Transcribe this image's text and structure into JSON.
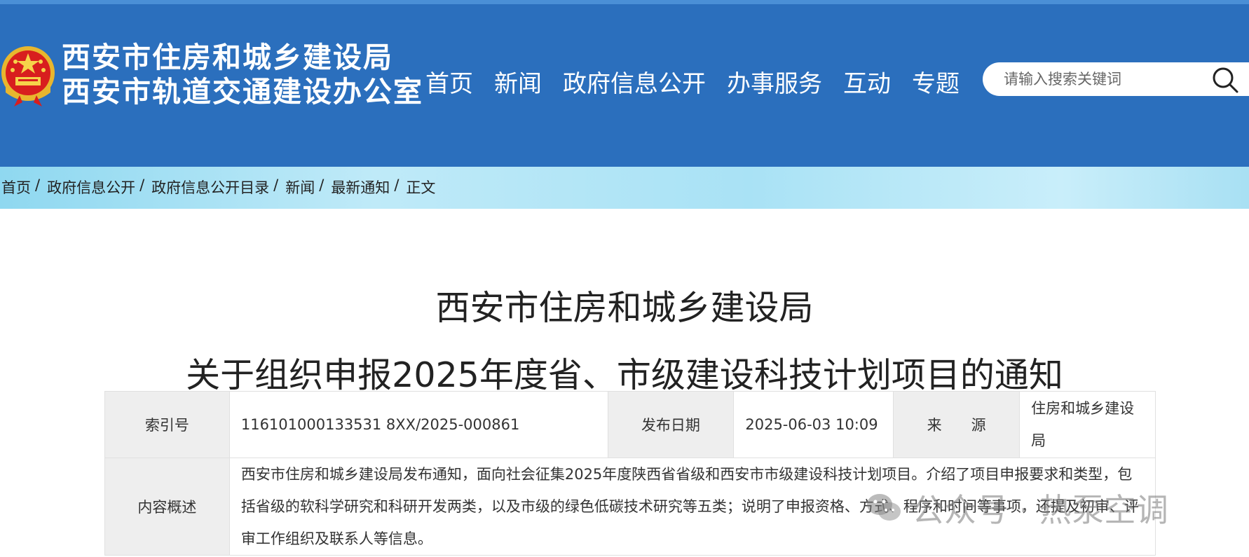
{
  "header": {
    "site_name_line1": "西安市住房和城乡建设局",
    "site_name_line2": "西安市轨道交通建设办公室",
    "emblem_icon": "national-emblem-icon",
    "nav": [
      "首页",
      "新闻",
      "政府信息公开",
      "办事服务",
      "互动",
      "专题"
    ],
    "search": {
      "placeholder": "请输入搜索关键词",
      "icon": "search-icon"
    },
    "colors": {
      "header_bg": "#2b6fbd"
    }
  },
  "breadcrumb": {
    "items": [
      "首页",
      "政府信息公开",
      "政府信息公开目录",
      "新闻",
      "最新通知"
    ],
    "separator": "/",
    "current": "正文"
  },
  "document": {
    "title_line1": "西安市住房和城乡建设局",
    "title_line2": "关于组织申报2025年度省、市级建设科技计划项目的通知",
    "meta": {
      "index_label": "索引号",
      "index_value": "116101000133531 8XX/2025-000861",
      "date_label": "发布日期",
      "date_value": "2025-06-03 10:09",
      "source_label": "来　　源",
      "source_value": "住房和城乡建设局",
      "summary_label": "内容概述",
      "summary_value": "西安市住房和城乡建设局发布通知，面向社会征集2025年度陕西省省级和西安市市级建设科技计划项目。介绍了项目申报要求和类型，包括省级的软科学研究和科研开发两类，以及市级的绿色低碳技术研究等五类；说明了申报资格、方式、程序和时间等事项，还提及初审、评审工作组织及联系人等信息。"
    }
  },
  "watermark": {
    "text": "公众号 · 热泵空调",
    "icon": "wechat-icon"
  }
}
